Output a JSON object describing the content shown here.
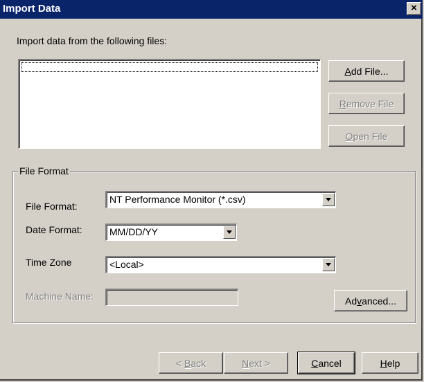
{
  "window": {
    "title": "Import Data",
    "close_label": "×"
  },
  "files_section": {
    "label": "Import data from the following files:",
    "add_file": {
      "pre": "",
      "key": "A",
      "post": "dd File..."
    },
    "remove_file": {
      "pre": "",
      "key": "R",
      "post": "emove File"
    },
    "open_file": {
      "pre": "",
      "key": "O",
      "post": "pen File"
    }
  },
  "file_format_group": {
    "legend": "File Format",
    "file_format_label": "File Format:",
    "file_format_value": "NT Performance Monitor (*.csv)",
    "date_format_label": "Date Format:",
    "date_format_value": "MM/DD/YY",
    "time_zone_label": "Time Zone",
    "time_zone_value": "<Local>",
    "machine_name_label": "Machine Name:",
    "machine_name_value": "",
    "advanced": {
      "pre": "Ad",
      "key": "v",
      "post": "anced..."
    }
  },
  "footer": {
    "back": {
      "pre": "< ",
      "key": "B",
      "post": "ack"
    },
    "next": {
      "pre": "",
      "key": "N",
      "post": "ext >"
    },
    "cancel": {
      "pre": "",
      "key": "C",
      "post": "ancel"
    },
    "help": {
      "pre": "",
      "key": "H",
      "post": "elp"
    }
  },
  "colors": {
    "title_bar": "#0a246a",
    "face": "#d4d0c8",
    "disabled_text": "#808080"
  }
}
